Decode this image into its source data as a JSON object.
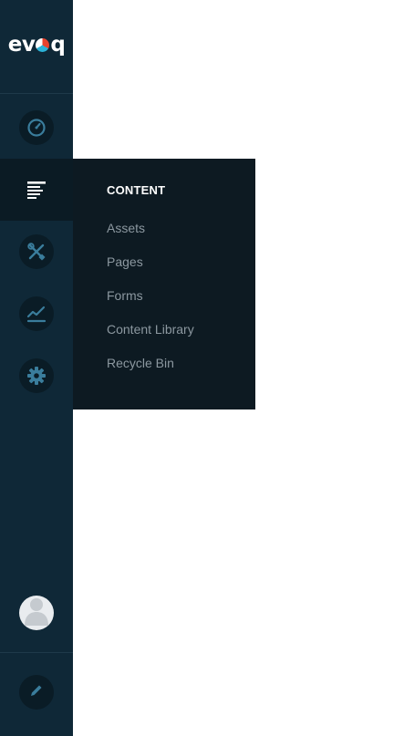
{
  "app": {
    "logo": {
      "text_left": "ev",
      "text_right": "q"
    }
  },
  "sidebar": {
    "items": [
      {
        "name": "dashboard",
        "icon": "gauge-icon",
        "active": false
      },
      {
        "name": "content",
        "icon": "content-icon",
        "active": true
      },
      {
        "name": "manage",
        "icon": "tools-icon",
        "active": false
      },
      {
        "name": "analytics",
        "icon": "chart-icon",
        "active": false
      },
      {
        "name": "settings",
        "icon": "gear-icon",
        "active": false
      }
    ],
    "user": {
      "icon": "user-avatar-icon"
    },
    "edit": {
      "icon": "pencil-icon"
    }
  },
  "flyout": {
    "title": "CONTENT",
    "items": [
      "Assets",
      "Pages",
      "Forms",
      "Content Library",
      "Recycle Bin"
    ]
  },
  "colors": {
    "sidebar_bg": "#0f2837",
    "flyout_bg": "#0d1a22",
    "active_item_bg": "#0b1b24",
    "icon_color": "#3a7d9c",
    "flyout_text": "#8c98a0"
  }
}
